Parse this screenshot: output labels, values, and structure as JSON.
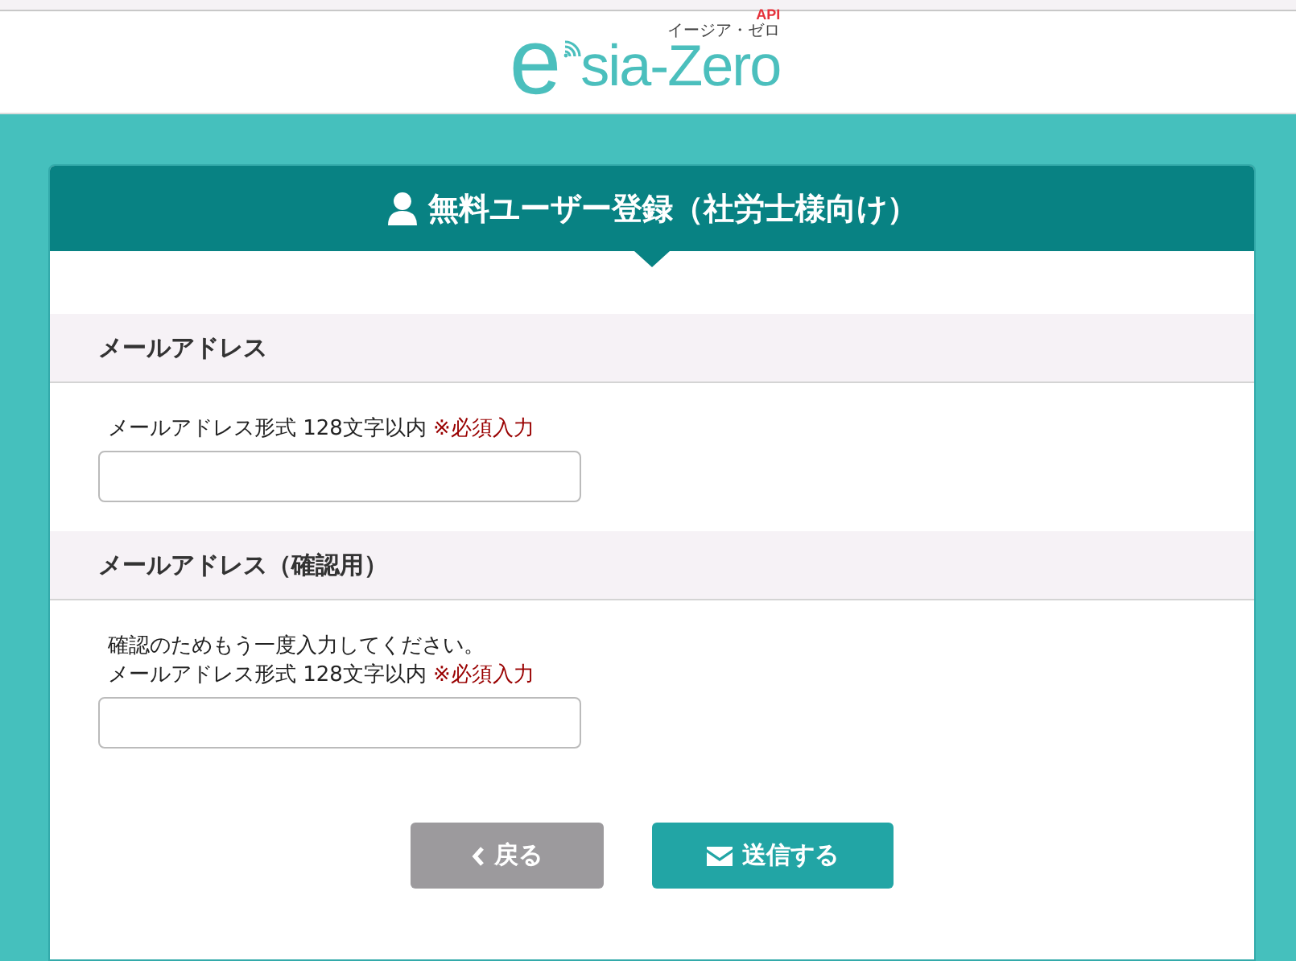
{
  "logo": {
    "mark": "e",
    "name": "sia-Zero",
    "badge": "API",
    "reading": "イージア・ゼロ"
  },
  "form": {
    "title": "無料ユーザー登録（社労士様向け）",
    "sections": [
      {
        "heading": "メールアドレス",
        "hint": "メールアドレス形式 128文字以内",
        "required": "※必須入力"
      },
      {
        "heading": "メールアドレス（確認用）",
        "notes": [
          "確認のためもう一度入力してください。"
        ],
        "hint": "メールアドレス形式 128文字以内",
        "required": "※必須入力"
      }
    ],
    "buttons": [
      {
        "kind": "back",
        "label": "戻る"
      },
      {
        "kind": "send",
        "label": "送信する"
      }
    ]
  }
}
